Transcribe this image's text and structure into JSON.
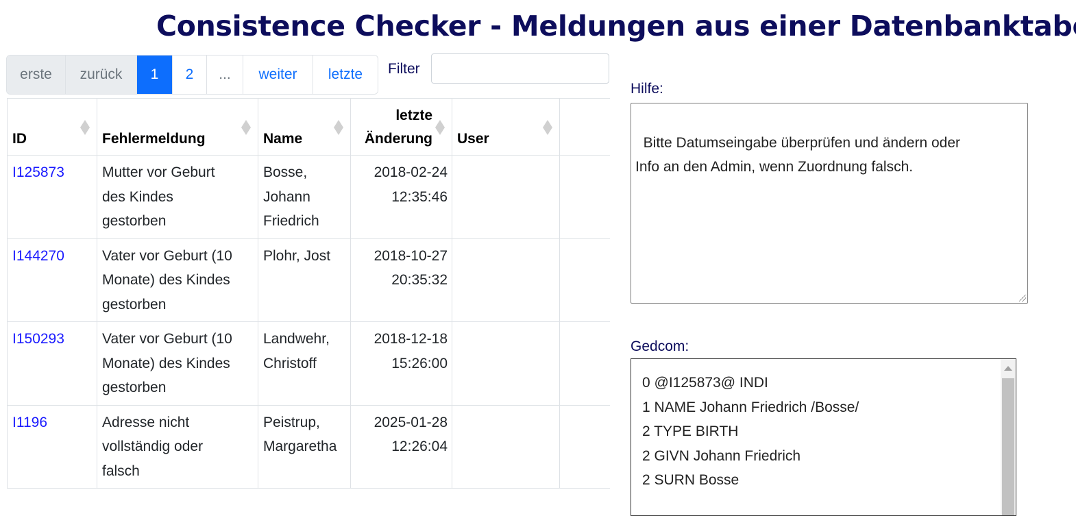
{
  "header": {
    "title": "Consistence Checker - Meldungen aus einer Datenbanktabelle"
  },
  "pagination": {
    "first": "erste",
    "prev": "zurück",
    "pages": [
      "1",
      "2"
    ],
    "ellipsis": "...",
    "next": "weiter",
    "last": "letzte",
    "active_page": "1"
  },
  "filter": {
    "label": "Filter",
    "value": ""
  },
  "table": {
    "columns": [
      {
        "line1": "",
        "line2": "ID"
      },
      {
        "line1": "",
        "line2": "Fehlermeldung"
      },
      {
        "line1": "",
        "line2": "Name"
      },
      {
        "line1": "letzte",
        "line2": "Änderung"
      },
      {
        "line1": "",
        "line2": "User"
      },
      {
        "line1": "",
        "line2": ""
      }
    ],
    "rows": [
      {
        "id": "I125873",
        "message": [
          "Mutter vor Geburt",
          "des Kindes",
          "gestorben"
        ],
        "name": [
          "Bosse,",
          "Johann",
          "Friedrich"
        ],
        "date": "2018-02-24",
        "time": "12:35:46",
        "user": ""
      },
      {
        "id": "I144270",
        "message": [
          "Vater vor Geburt (10",
          "Monate) des Kindes",
          "gestorben"
        ],
        "name": [
          "Plohr, Jost"
        ],
        "date": "2018-10-27",
        "time": "20:35:32",
        "user": ""
      },
      {
        "id": "I150293",
        "message": [
          "Vater vor Geburt (10",
          "Monate) des Kindes",
          "gestorben"
        ],
        "name": [
          "Landwehr,",
          "Christoff"
        ],
        "date": "2018-12-18",
        "time": "15:26:00",
        "user": ""
      },
      {
        "id": "I1196",
        "message": [
          "Adresse nicht",
          "vollständig oder",
          "falsch"
        ],
        "name": [
          "Peistrup,",
          "Margaretha"
        ],
        "date": "2025-01-28",
        "time": "12:26:04",
        "user": ""
      }
    ]
  },
  "help": {
    "label": "Hilfe:",
    "text": "Bitte Datumseingabe überprüfen und ändern oder\nInfo an den Admin, wenn Zuordnung falsch."
  },
  "gedcom": {
    "label": "Gedcom:",
    "lines": [
      "0 @I125873@ INDI",
      "1 NAME Johann Friedrich /Bosse/",
      "2 TYPE BIRTH",
      "2 GIVN Johann Friedrich",
      "2 SURN Bosse"
    ]
  }
}
